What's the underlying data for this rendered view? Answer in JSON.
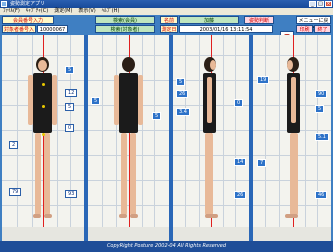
{
  "window": {
    "title": "姿勢測定アプリ"
  },
  "menu": [
    "ﾌｧｲﾙ(F)",
    "ｷｬﾌﾟﾁｬ(C)",
    "測定(M)",
    "表示(V)",
    "ﾍﾙﾌﾟ(H)"
  ],
  "toolbar": {
    "client_button": "会員番号入力",
    "client_no_label": "対象者番号入力",
    "client_no": "10000067",
    "search_top": "検索(会員)",
    "search_bottom": "検索(対象者)",
    "name_label": "名前",
    "name_value": "加藤",
    "measure_label": "測定日付",
    "date_label": "撮影日時",
    "date_value": "2003/01/16 13:11:54",
    "posture_button": "姿勢判断",
    "menu_button": "メニューに戻る",
    "print_button": "印刷",
    "exit_button": "終了"
  },
  "panels": [
    {
      "name": "front",
      "tags": [
        "5",
        "12",
        "5",
        "0",
        "2",
        "79",
        "93"
      ]
    },
    {
      "name": "back",
      "tags": [
        "5",
        "5"
      ]
    },
    {
      "name": "side-right",
      "tags": [
        "5",
        "26",
        "0",
        "3.4",
        "14",
        "26"
      ]
    },
    {
      "name": "side-left",
      "tags": [
        "19",
        "90",
        "5",
        "5.1",
        "7",
        "46"
      ]
    }
  ],
  "footer": {
    "copyright": "CopyRight Posture 2002-04 All Rights Reserved"
  },
  "colors": {
    "accent": "#2d72c8",
    "redline": "#e02020",
    "frame": "#0f4aa0"
  }
}
